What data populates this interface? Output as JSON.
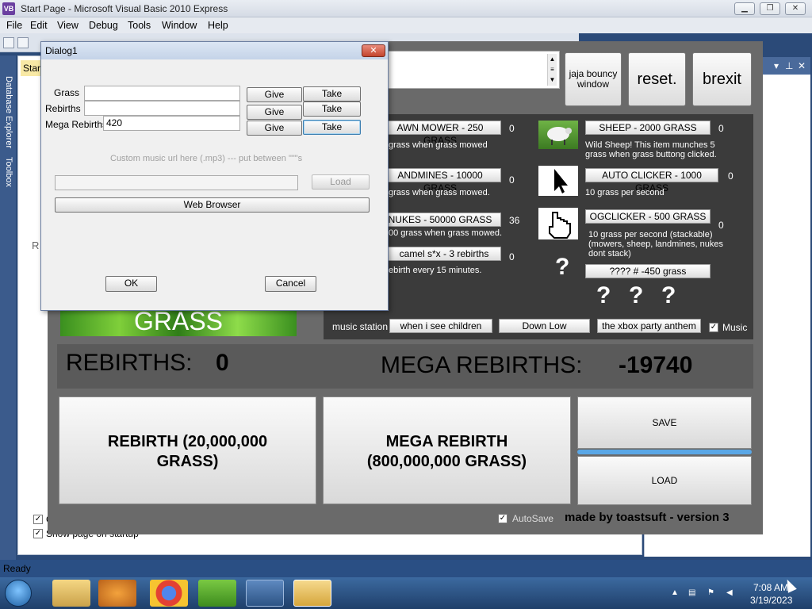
{
  "vs": {
    "title": "Start Page - Microsoft Visual Basic 2010 Express",
    "logo": "VB",
    "menu": [
      "File",
      "Edit",
      "View",
      "Debug",
      "Tools",
      "Window",
      "Help"
    ],
    "start_tab": "Start",
    "side_labels": [
      "Database Explorer",
      "Toolbox"
    ],
    "behind_letter": "R",
    "behind_checks": [
      "C",
      "Show page on startup"
    ],
    "status": "Ready",
    "window_controls": [
      "minimize-icon",
      "restore-icon",
      "close-icon"
    ]
  },
  "dialog": {
    "title": "Dialog1",
    "close_glyph": "✕",
    "rows": [
      {
        "label": "Grass",
        "value": "",
        "give": "Give",
        "take": "Take"
      },
      {
        "label": "Rebirths",
        "value": "",
        "give": "Give",
        "take": "Take"
      },
      {
        "label": "Mega Rebirths",
        "value": "420",
        "give": "Give",
        "take": "Take"
      }
    ],
    "music_hint": "Custom music url here (.mp3) --- put between \"\"\"s",
    "music_url": "",
    "load": "Load",
    "web_browser": "Web Browser",
    "ok": "OK",
    "cancel": "Cancel"
  },
  "game": {
    "top_buttons": {
      "bouncy": "jaja bouncy window",
      "reset": "reset.",
      "brexit": "brexit"
    },
    "shop_left": [
      {
        "button": "AWN MOWER - 250 GRASS",
        "count": "0",
        "desc": "grass when grass mowed"
      },
      {
        "button": "ANDMINES - 10000 GRASS",
        "count": "0",
        "desc": "grass when grass mowed."
      },
      {
        "button": "NUKES - 50000 GRASS",
        "count": "36",
        "desc": "00 grass when grass mowed."
      },
      {
        "button": "camel s*x - 3 rebirths",
        "count": "0",
        "desc": "ebirth every 15 minutes."
      }
    ],
    "shop_right": [
      {
        "button": "SHEEP - 2000 GRASS",
        "count": "0",
        "desc": "Wild Sheep! This item munches 5 grass when grass buttong clicked."
      },
      {
        "button": "AUTO CLICKER - 1000 GRASS",
        "count": "0",
        "desc": "10 grass per second"
      },
      {
        "button": "OGCLICKER - 500 GRASS",
        "count": "0",
        "desc": "10 grass per second (stackable) (mowers, sheep, landmines, nukes dont stack)"
      },
      {
        "button": "???? # -450 grass",
        "count": "",
        "desc": ""
      }
    ],
    "question_marks": [
      "?",
      "?",
      "?",
      "?"
    ],
    "music_station_label": "music station",
    "songs": [
      "when i see children",
      "Down Low",
      "the xbox party anthem"
    ],
    "music_check": "Music",
    "grass_text": "GRASS",
    "rebirths_label": "REBIRTHS:",
    "rebirths_value": "0",
    "mega_label": "MEGA REBIRTHS:",
    "mega_value": "-19740",
    "rebirth_btn": "REBIRTH (20,000,000 GRASS)",
    "mega_btn": "MEGA REBIRTH (800,000,000 GRASS)",
    "save": "SAVE",
    "load": "LOAD",
    "autosave": "AutoSave",
    "credit": "made by toastsuft - version 3",
    "check_glyph": "✓"
  },
  "taskbar": {
    "time": "7:08 AM",
    "date": "3/19/2023"
  }
}
